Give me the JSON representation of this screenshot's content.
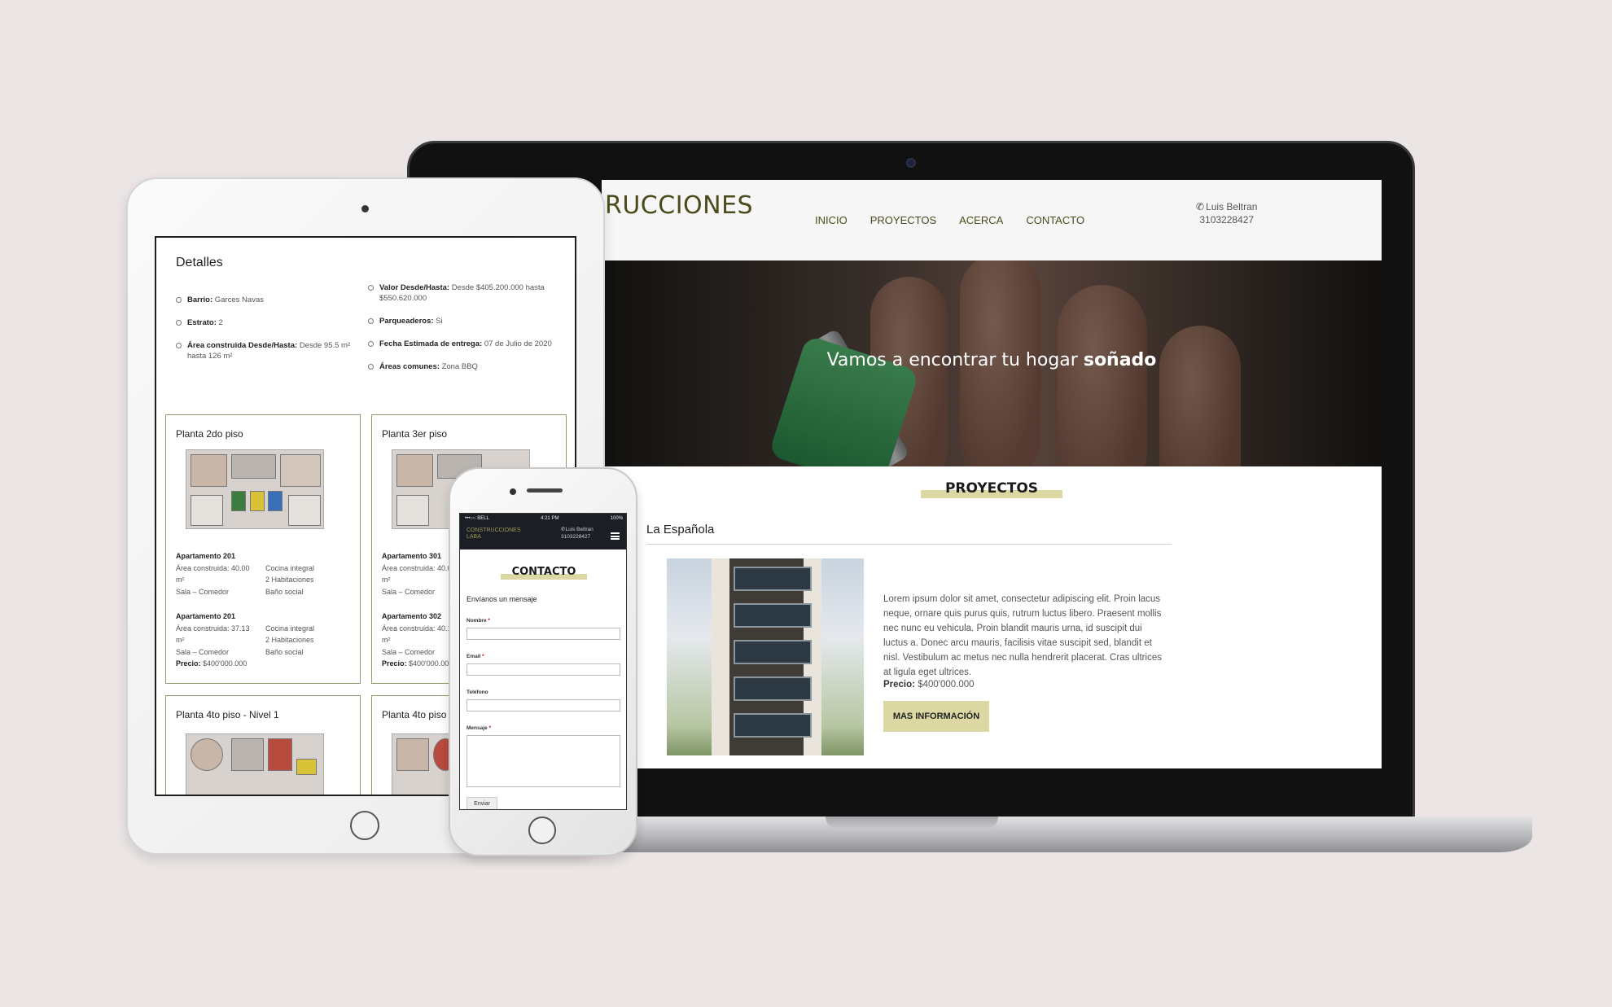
{
  "laptop": {
    "brand": "RUCCIONES",
    "nav": [
      "INICIO",
      "PROYECTOS",
      "ACERCA",
      "CONTACTO"
    ],
    "contact_name": "Luis Beltran",
    "contact_phone": "3103228427",
    "hero_text": "Vamos a encontrar tu hogar",
    "hero_emph": "soñado",
    "section_title": "PROYECTOS",
    "project_name": "La Española",
    "project_desc": "Lorem ipsum dolor sit amet, consectetur adipiscing elit. Proin lacus neque, ornare quis purus quis, rutrum luctus libero. Praesent mollis nec nunc eu vehicula. Proin blandit mauris urna, id suscipit dui luctus a. Donec arcu mauris, facilisis vitae suscipit sed, blandit et nisl. Vestibulum ac metus nec nulla hendrerit placerat. Cras ultrices at ligula eget ultrices.",
    "price_label": "Precio:",
    "price_value": "$400'000.000",
    "button_label": "MAS INFORMACIÓN"
  },
  "tablet": {
    "details_title": "Detalles",
    "details_left": [
      {
        "label": "Barrio:",
        "value": "Garces Navas"
      },
      {
        "label": "Estrato:",
        "value": "2"
      },
      {
        "label": "Área construida Desde/Hasta:",
        "value": "Desde 95.5 m² hasta 126 m²"
      }
    ],
    "details_right": [
      {
        "label": "Valor Desde/Hasta:",
        "value": "Desde $405.200.000 hasta $550.620.000"
      },
      {
        "label": "Parqueaderos:",
        "value": "Si"
      },
      {
        "label": "Fecha Estimada de entrega:",
        "value": "07 de Julio de 2020"
      },
      {
        "label": "Áreas comunes:",
        "value": "Zona BBQ"
      }
    ],
    "cards": [
      {
        "title": "Planta 2do piso",
        "apartments": [
          {
            "name": "Apartamento 201",
            "area": "Área construida: 40.00",
            "unit": "m²",
            "room": "Sala – Comedor",
            "c1": "Cocina integral",
            "c2": "2 Habitaciones",
            "c3": "Baño social",
            "price": ""
          },
          {
            "name": "Apartamento 201",
            "area": "Área construida: 37.13",
            "unit": "m²",
            "room": "Sala – Comedor",
            "c1": "Cocina integral",
            "c2": "2 Habitaciones",
            "c3": "Baño social",
            "price": "$400'000.000"
          }
        ]
      },
      {
        "title": "Planta 3er piso",
        "apartments": [
          {
            "name": "Apartamento 301",
            "area": "Área construida: 40.0",
            "unit": "m²",
            "room": "Sala – Comedor",
            "c1": "",
            "c2": "",
            "c3": "",
            "price": ""
          },
          {
            "name": "Apartamento 302",
            "area": "Área construida: 40.1",
            "unit": "m²",
            "room": "Sala – Comedor",
            "c1": "",
            "c2": "",
            "c3": "",
            "price": "$400'000.000"
          }
        ]
      },
      {
        "title": "Planta 4to piso - Nivel 1"
      },
      {
        "title": "Planta 4to piso"
      }
    ],
    "price_label": "Precio:"
  },
  "phone": {
    "status_left": "•••○○ BELL",
    "status_time": "4:21 PM",
    "status_right": "100%",
    "brand_line1": "CONSTRUCCIONES",
    "brand_line2": "LABA",
    "contact_name": "Luis Beltran",
    "contact_phone": "3103228427",
    "section_title": "CONTACTO",
    "subtitle": "Envíanos un mensaje",
    "fields": {
      "nombre": "Nombre",
      "email": "Email",
      "telefono": "Teléfono",
      "mensaje": "Mensaje"
    },
    "required_mark": "*",
    "send_label": "Enviar"
  }
}
